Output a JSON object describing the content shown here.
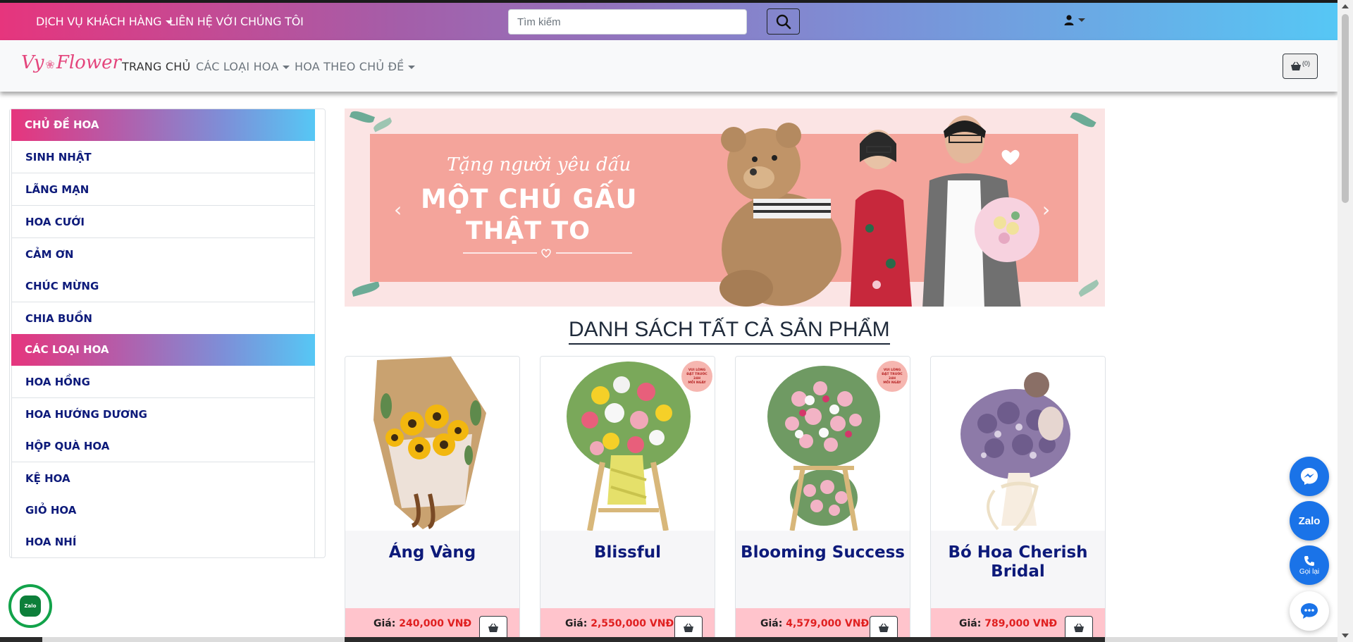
{
  "topbar": {
    "customer_service": "DỊCH VỤ KHÁCH HÀNG",
    "contact": "LIÊN HỆ VỚI CHÚNG TÔI",
    "search_placeholder": "Tìm kiếm"
  },
  "navbar": {
    "logo_text_1": "Vy",
    "logo_text_2": "Flower",
    "home": "TRANG CHỦ",
    "flower_types": "CÁC LOẠI HOA",
    "by_theme": "HOA THEO CHỦ ĐỀ",
    "cart_count": "(0)"
  },
  "sidebar": {
    "themes_header": "CHỦ ĐỀ HOA",
    "themes": [
      {
        "label": "SINH NHẬT"
      },
      {
        "label": "LÃNG MẠN"
      },
      {
        "label": "HOA CƯỚI"
      },
      {
        "label": "CẢM ƠN"
      },
      {
        "label": "CHÚC MỪNG"
      },
      {
        "label": "CHIA BUỒN"
      }
    ],
    "types_header": "CÁC LOẠI HOA",
    "types": [
      {
        "label": "HOA HỒNG"
      },
      {
        "label": "HOA HƯỚNG DƯƠNG"
      },
      {
        "label": "HỘP QUÀ HOA"
      },
      {
        "label": "KỆ HOA"
      },
      {
        "label": "GIỎ HOA"
      },
      {
        "label": "HOA NHÍ"
      }
    ]
  },
  "banner": {
    "line1": "Tặng người yêu dấu",
    "line2": "MỘT CHÚ GẤU",
    "line3": "THẬT TO"
  },
  "products": {
    "section_title": "DANH SÁCH TẤT CẢ SẢN PHẨM",
    "price_label": "Giá:",
    "preorder_badge_1": "VUI LÒNG",
    "preorder_badge_2": "ĐẶT TRƯỚC",
    "preorder_badge_3": "24H",
    "preorder_badge_4": "MỖI NGÀY",
    "items": [
      {
        "name": "Áng Vàng",
        "price": "240,000 VNĐ"
      },
      {
        "name": "Blissful",
        "price": "2,550,000 VNĐ"
      },
      {
        "name": "Blooming Success",
        "price": "4,579,000 VNĐ"
      },
      {
        "name": "Bó Hoa Cherish Bridal",
        "price": "789,000 VNĐ"
      }
    ]
  },
  "floating": {
    "zalo": "Zalo",
    "call": "Gọi lại",
    "zalo_small": "Zalo"
  },
  "colors": {
    "gradient_start": "#e6357d",
    "gradient_end": "#56c7f5",
    "link_navy": "#0d1a7a",
    "price_red": "#e02020",
    "card_footer_pink": "#ffc4cc",
    "fab_blue": "#1a73e8"
  },
  "icons": {
    "search": "search-icon",
    "user": "user-icon",
    "cart": "basket-icon",
    "messenger": "messenger-icon",
    "phone": "phone-icon",
    "chat": "chat-bubble-icon"
  }
}
